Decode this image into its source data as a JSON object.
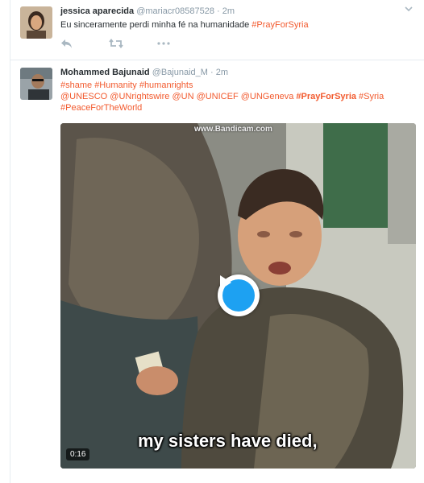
{
  "tweets": [
    {
      "fullname": "jessica aparecida",
      "username": "@mariacr08587528",
      "separator": "·",
      "time": "2m",
      "text": "Eu sinceramente perdi minha fé na humanidade ",
      "hashtag": "#PrayForSyria"
    },
    {
      "fullname": "Mohammed Bajunaid",
      "username": "@Bajunaid_M",
      "separator": "·",
      "time": "2m",
      "line1": "#shame #Humanity #humanrights",
      "line2_parts": [
        "@UNESCO @UNrightswire @UN @UNICEF @UNGeneva ",
        "#PrayForSyria",
        " #Syria"
      ],
      "line3": "#PeaceForTheWorld",
      "video": {
        "watermark": "www.Bandicam.com",
        "subtitle": "my sisters have died,",
        "duration": "0:16"
      }
    }
  ],
  "icons": {
    "chevron": "chevron-down-icon",
    "reply": "reply-icon",
    "retweet": "retweet-icon",
    "like": "like-icon",
    "more": "more-icon",
    "play": "play-icon"
  },
  "colors": {
    "hashtag": "#f25a2e",
    "muted": "#8899a6",
    "play_button": "#1da1f2"
  }
}
